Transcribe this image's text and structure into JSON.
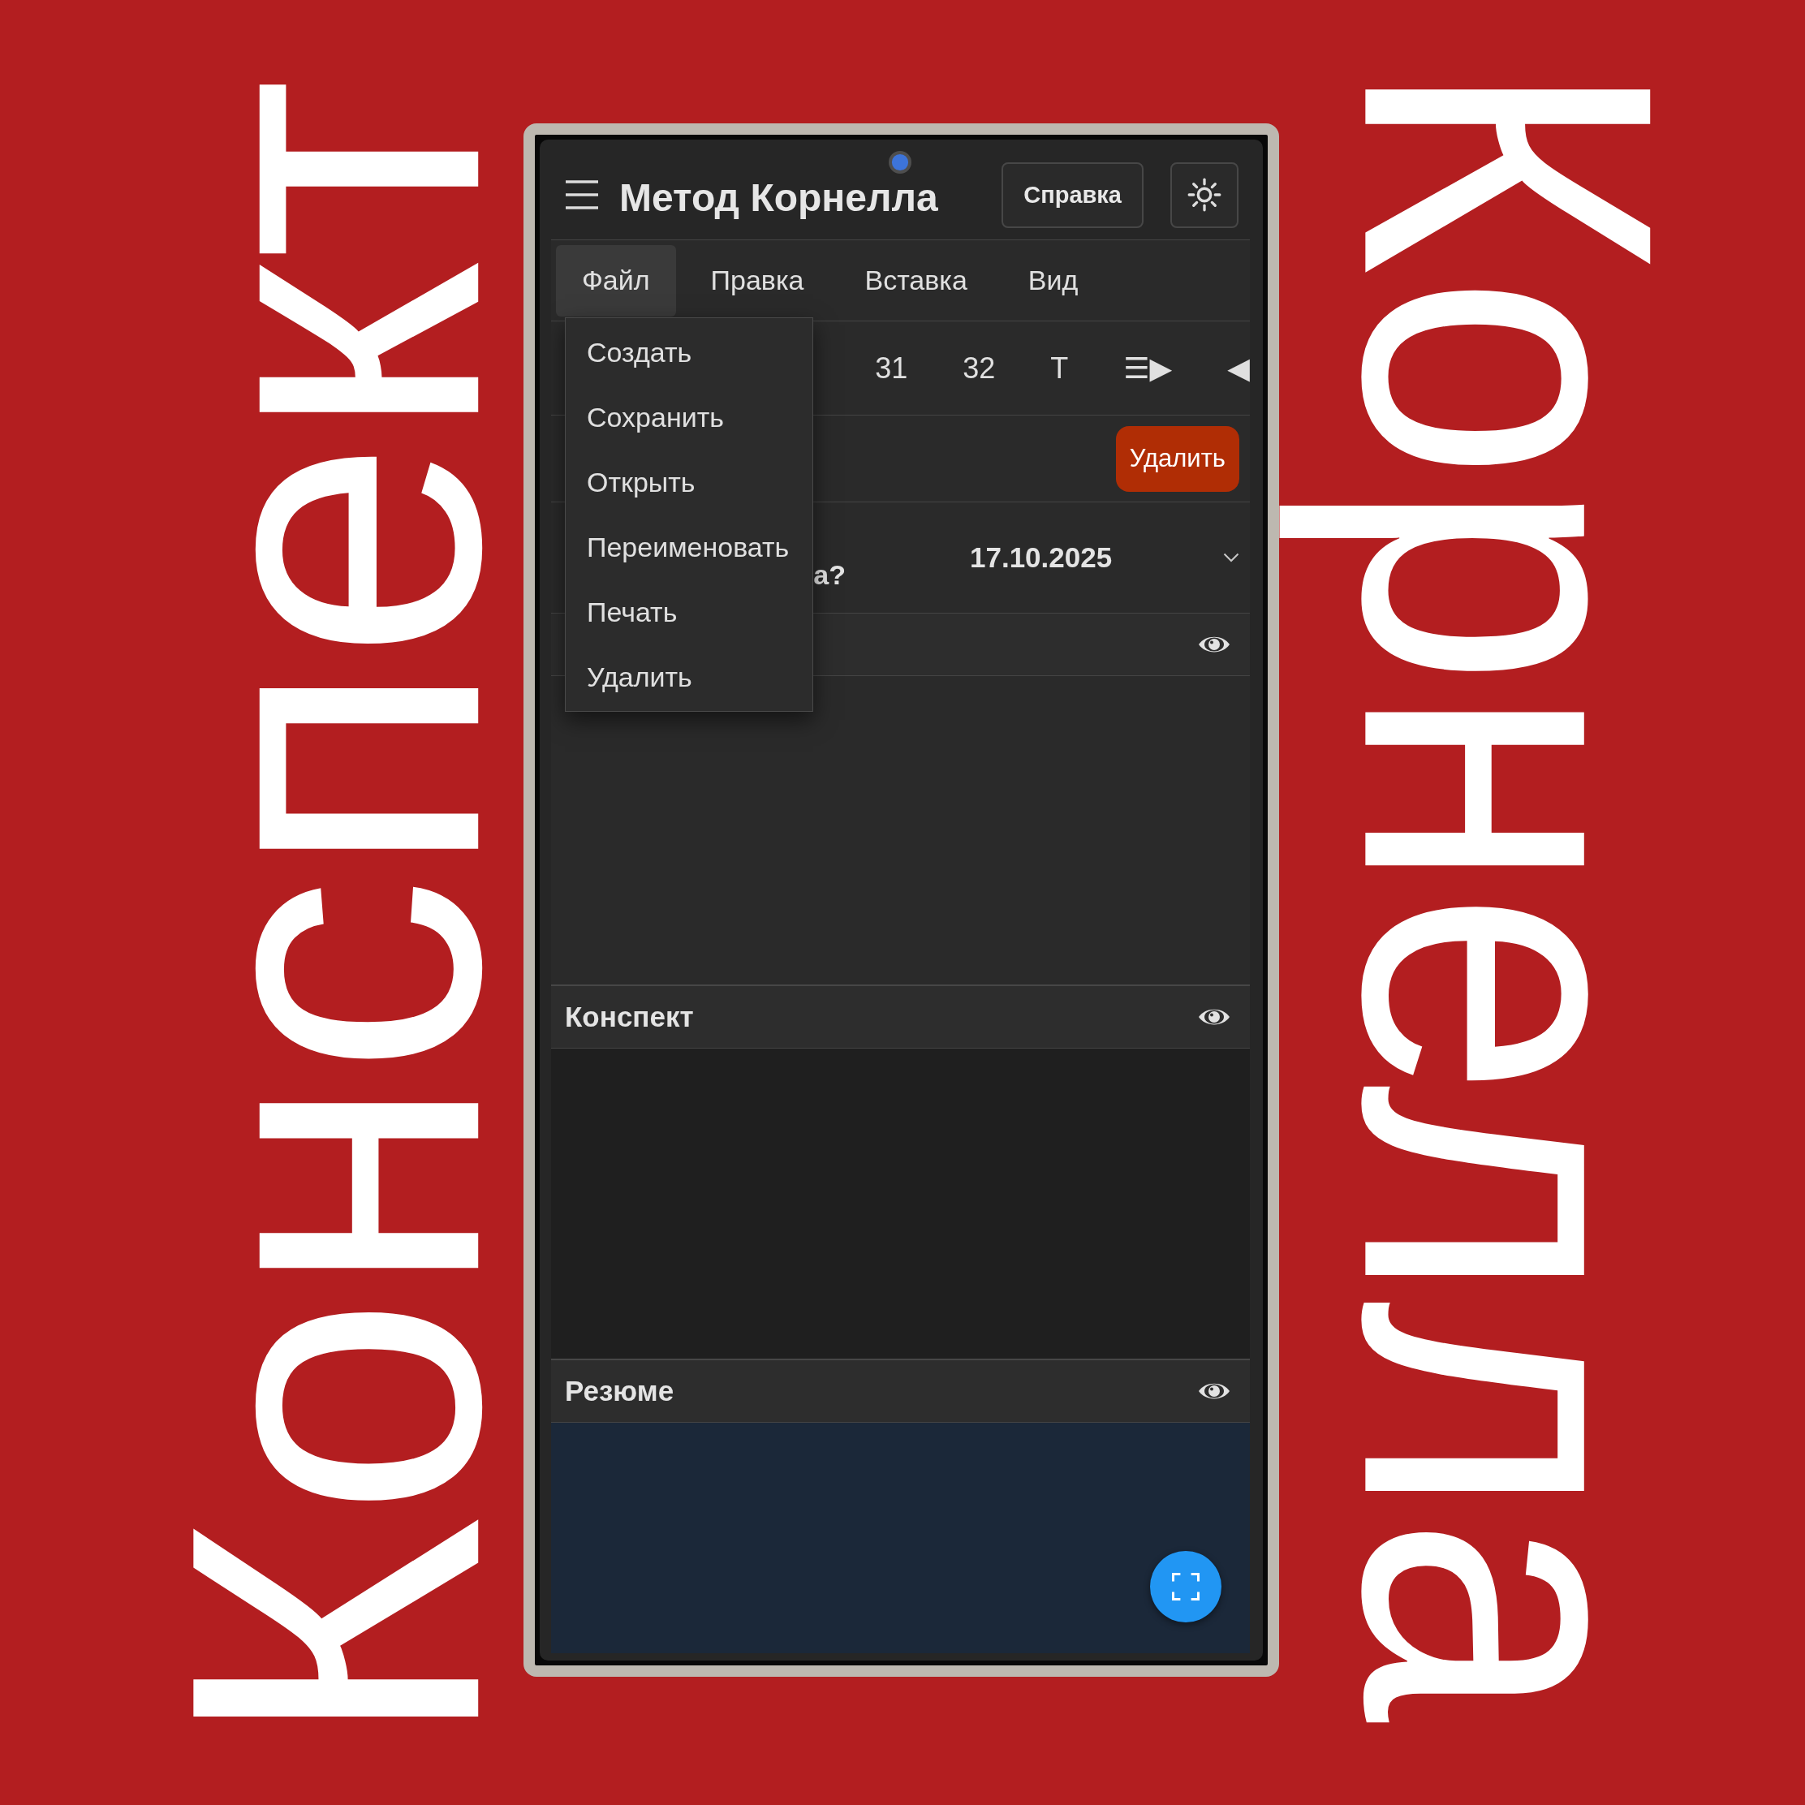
{
  "poster": {
    "left_text": "Конспект",
    "right_text": "Корнелла"
  },
  "app_bar": {
    "title": "Метод Корнелла",
    "help_button": "Справка"
  },
  "menu_bar": [
    {
      "label": "Файл",
      "selected": true,
      "items": [
        "Создать",
        "Сохранить",
        "Открыть",
        "Переименовать",
        "Печать",
        "Удалить"
      ]
    },
    {
      "label": "Правка",
      "selected": false
    },
    {
      "label": "Вставка",
      "selected": false
    },
    {
      "label": "Вид",
      "selected": false
    }
  ],
  "toolbar": [
    "31",
    "32",
    "T",
    "☰▶",
    "◀"
  ],
  "delete_button": "Удалить",
  "topic_row": {
    "question": "а?",
    "date": "17.10.2025"
  },
  "sections": [
    {
      "kind": "cues"
    },
    {
      "kind": "notes",
      "title": "Конспект"
    },
    {
      "kind": "summary",
      "title": "Резюме"
    }
  ]
}
